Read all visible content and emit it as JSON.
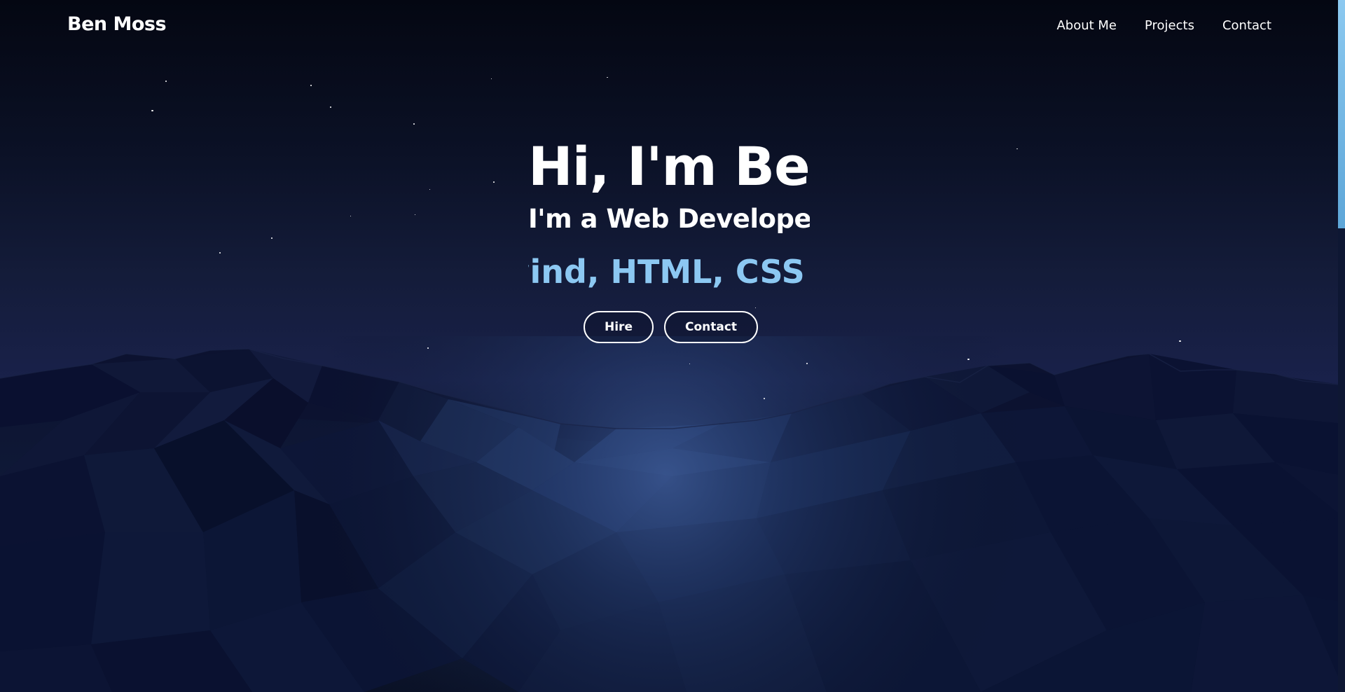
{
  "navbar": {
    "brand": "Ben Moss",
    "links": [
      "About Me",
      "Projects",
      "Contact"
    ]
  },
  "hero": {
    "title": "Hi, I'm Ben",
    "subtitle": "I'm a Web Developer",
    "skills_ticker": "Tailwind,  HTML, CSS"
  },
  "buttons": {
    "hire": "Hire",
    "contact": "Contact"
  },
  "colors": {
    "background_top": "#040712",
    "background_mid": "#19214a",
    "accent_text": "#8cc8f2",
    "scrollbar_thumb": "#8cc9f0"
  }
}
